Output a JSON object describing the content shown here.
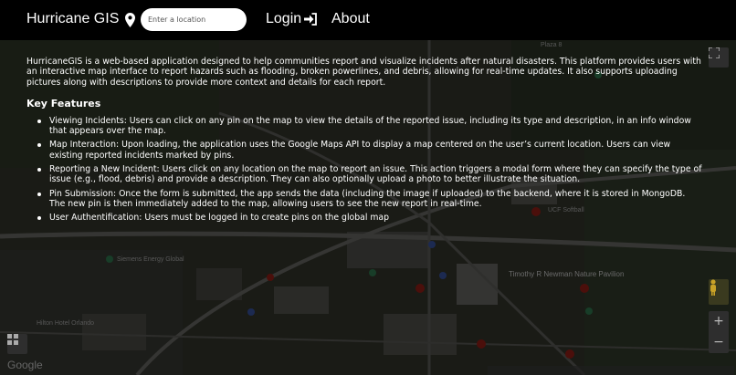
{
  "navbar": {
    "brand": "Hurricane GIS",
    "search_placeholder": "Enter a location",
    "login_label": "Login",
    "about_label": "About"
  },
  "content": {
    "intro": "HurricaneGIS is a web-based application designed to help communities report and visualize incidents after natural disasters. This platform provides users with an interactive map interface to report hazards such as flooding, broken powerlines, and debris, allowing for real-time updates. It also supports uploading pictures along with descriptions to provide more context and details for each report.",
    "features_heading": "Key Features",
    "features": [
      "Viewing Incidents: Users can click on any pin on the map to view the details of the reported issue, including its type and description, in an info window that appears over the map.",
      "Map Interaction: Upon loading, the application uses the Google Maps API to display a map centered on the user’s current location. Users can view existing reported incidents marked by pins.",
      "Reporting a New Incident: Users click on any location on the map to report an issue. This action triggers a modal form where they can specify the type of issue (e.g., flood, debris) and provide a description. They can also optionally upload a photo to better illustrate the situation.",
      "Pin Submission: Once the form is submitted, the app sends the data (including the image if uploaded) to the backend, where it is stored in MongoDB. The new pin is then immediately added to the map, allowing users to see the new report in real-time.",
      "User Authentification: Users must be logged in to create pins on the global map"
    ]
  },
  "map": {
    "labels": [
      "Timothy R Newman Nature Pavilion",
      "Hilton Hotel Orlando",
      "UCF Softball",
      "Siemens Energy Global",
      "Plaza 8"
    ],
    "logo_text": "Google",
    "zoom_in": "+",
    "zoom_out": "−"
  },
  "colors": {
    "navbar_bg": "#000000",
    "text": "#ffffff",
    "search_bg": "#ffffff",
    "pin_red": "#c4281e"
  },
  "icons": {
    "location": "map-marker-icon",
    "login": "sign-in-icon",
    "fullscreen": "fullscreen-icon",
    "pegman": "pegman-icon",
    "layers": "layers-icon"
  }
}
